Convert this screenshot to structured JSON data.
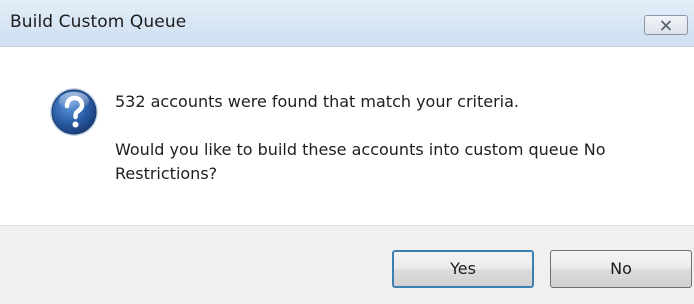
{
  "window": {
    "title": "Build Custom Queue"
  },
  "message": {
    "line1": "532 accounts were found that match your criteria.",
    "line2": "Would you like to build these accounts into custom queue No Restrictions?"
  },
  "buttons": {
    "yes_label": "Yes",
    "no_label": "No"
  },
  "icons": {
    "dialog": "question-icon",
    "close": "close-icon"
  },
  "colors": {
    "title_bar": "#d8e6f4",
    "icon_blue": "#2b5fa8",
    "footer": "#f0f0f0",
    "default_button_border": "#3c7fb1"
  }
}
